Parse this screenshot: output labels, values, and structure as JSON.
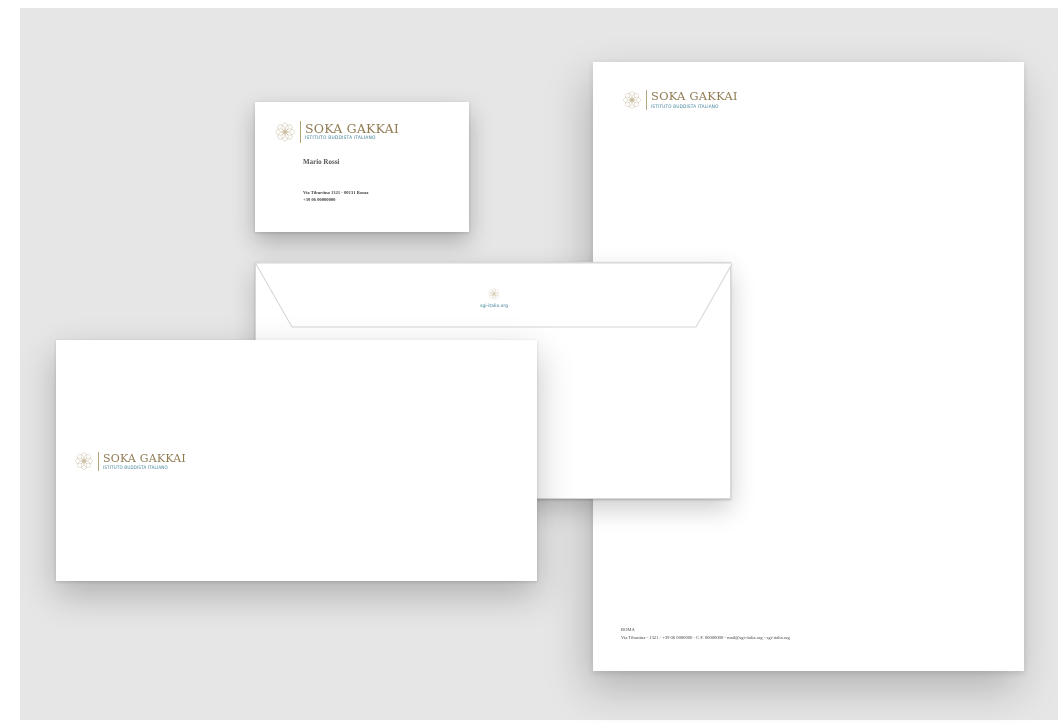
{
  "brand": {
    "name": "SOKA GAKKAI",
    "subtitle": "ISTITUTO BUDDISTA ITALIANO",
    "gold_color": "#8f7a52",
    "teal_color": "#3b7d97",
    "logo_icon": "lotus-mandala-icon"
  },
  "business_card": {
    "name": "Mario Rossi",
    "address": "Via Tiburtina 1321 - 00131 Roma",
    "phone": "+39 06 00000000"
  },
  "envelope_flap": {
    "url": "sgi-italia.org"
  },
  "letterhead": {
    "city": "ROMA",
    "footer": "Via Tiburtina - 1321  -  +39 06 0000000  -  C.F. 00000000 -  mail@sgi-italia.org  -  sgi-italia.org"
  }
}
